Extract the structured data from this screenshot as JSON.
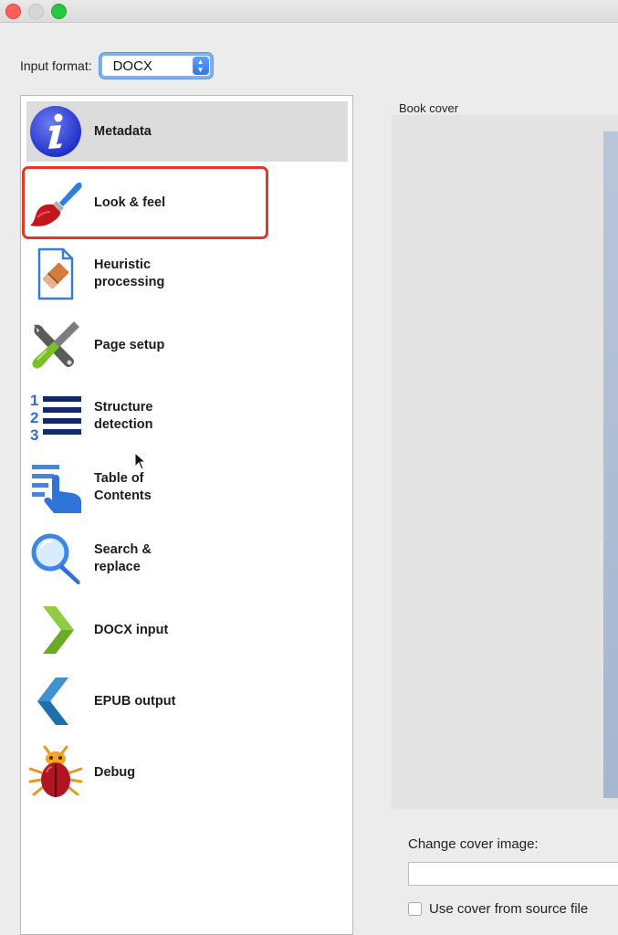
{
  "window": {
    "controls": [
      "close",
      "minimize",
      "maximize"
    ]
  },
  "input_format": {
    "label": "Input format:",
    "selected": "DOCX"
  },
  "sidebar": {
    "selected_index": 0,
    "highlighted_index": 1,
    "items": [
      {
        "label": "Metadata",
        "icon": "info-icon"
      },
      {
        "label": "Look & feel",
        "icon": "paintbrush-icon"
      },
      {
        "label": "Heuristic processing",
        "icon": "document-eraser-icon"
      },
      {
        "label": "Page setup",
        "icon": "wrench-screwdriver-icon"
      },
      {
        "label": "Structure detection",
        "icon": "numbered-list-icon"
      },
      {
        "label": "Table of Contents",
        "icon": "toc-pointer-icon"
      },
      {
        "label": "Search & replace",
        "icon": "magnifier-icon"
      },
      {
        "label": "DOCX input",
        "icon": "chevron-right-icon"
      },
      {
        "label": "EPUB output",
        "icon": "chevron-left-icon"
      },
      {
        "label": "Debug",
        "icon": "bug-icon"
      }
    ]
  },
  "cover": {
    "title": "Book cover",
    "change_label": "Change cover image:",
    "change_value": "",
    "use_source_label": "Use cover from source file",
    "use_source_checked": false
  },
  "colors": {
    "highlight_border": "#e03a25",
    "selected_row": "#dcdcdc",
    "select_accent": "#2f76e6"
  }
}
